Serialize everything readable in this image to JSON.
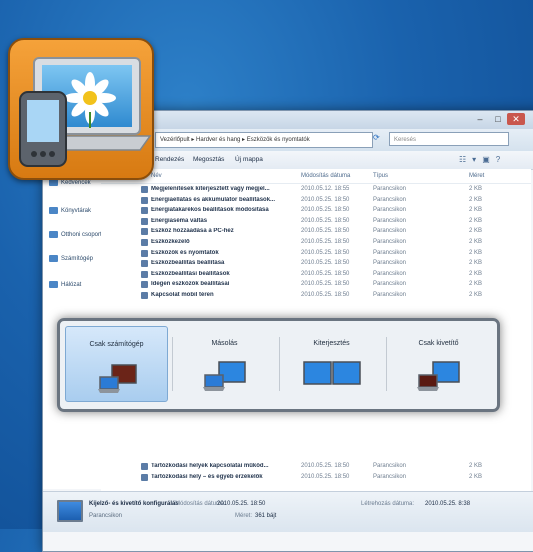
{
  "titlebar": {
    "min": "–",
    "max": "□",
    "close": "✕"
  },
  "address": {
    "path": "Vezérlőpult ▸ Hardver és hang ▸ Eszközök és nyomtatók",
    "search_placeholder": "Keresés"
  },
  "commandbar": {
    "items": [
      "Rendezés",
      "Megosztás",
      "Új mappa"
    ]
  },
  "nav": {
    "items": [
      "Kedvencek",
      "Könyvtárak",
      "Otthoni csoport",
      "Számítógép",
      "Hálózat"
    ]
  },
  "columns": {
    "name": "Név",
    "date": "Módosítás dátuma",
    "type": "Típus",
    "size": "Méret"
  },
  "files": [
    {
      "name": "Megjelenítések kiterjesztett vagy megjel...",
      "date": "2010.05.12. 18:55",
      "type": "Parancsikon",
      "size": "2 KB"
    },
    {
      "name": "Energiaellátás és akkumulátor beállítások...",
      "date": "2010.05.25. 18:50",
      "type": "Parancsikon",
      "size": "2 KB"
    },
    {
      "name": "Energiatakarékos beállítások módosítása",
      "date": "2010.05.25. 18:50",
      "type": "Parancsikon",
      "size": "2 KB"
    },
    {
      "name": "Energiaséma váltás",
      "date": "2010.05.25. 18:50",
      "type": "Parancsikon",
      "size": "2 KB"
    },
    {
      "name": "Eszköz hozzáadása a PC-hez",
      "date": "2010.05.25. 18:50",
      "type": "Parancsikon",
      "size": "2 KB"
    },
    {
      "name": "Eszközkezelő",
      "date": "2010.05.25. 18:50",
      "type": "Parancsikon",
      "size": "2 KB"
    },
    {
      "name": "Eszközök és nyomtatók",
      "date": "2010.05.25. 18:50",
      "type": "Parancsikon",
      "size": "2 KB"
    },
    {
      "name": "Eszközbeállítás beállítása",
      "date": "2010.05.25. 18:50",
      "type": "Parancsikon",
      "size": "2 KB"
    },
    {
      "name": "Eszközbeállítási beállítások",
      "date": "2010.05.25. 18:50",
      "type": "Parancsikon",
      "size": "2 KB"
    },
    {
      "name": "Idegen eszközök beállításai",
      "date": "2010.05.25. 18:50",
      "type": "Parancsikon",
      "size": "2 KB"
    },
    {
      "name": "Kapcsolat mobil téren",
      "date": "2010.05.25. 18:50",
      "type": "Parancsikon",
      "size": "2 KB"
    }
  ],
  "files_after": [
    {
      "name": "Tartózkodási helyek kapcsolatai működ...",
      "date": "2010.05.25. 18:50",
      "type": "Parancsikon",
      "size": "2 KB"
    },
    {
      "name": "Tartózkodási hely – és egyéb érzékelők",
      "date": "2010.05.25. 18:50",
      "type": "Parancsikon",
      "size": "2 KB"
    }
  ],
  "project": {
    "options": [
      {
        "label": "Csak számítógép",
        "selected": true
      },
      {
        "label": "Másolás",
        "selected": false
      },
      {
        "label": "Kiterjesztés",
        "selected": false
      },
      {
        "label": "Csak kivetítő",
        "selected": false
      }
    ]
  },
  "details": {
    "name": "Kijelző- és kivetítő konfigurálás",
    "subtitle": "Parancsikon",
    "k1": "Módosítás dátuma:",
    "v1": "2010.05.25. 18:50",
    "k2": "Létrehozás dátuma:",
    "v2": "2010.05.25. 8:38",
    "k3": "Méret:",
    "v3": "361 bájt"
  },
  "colors": {
    "accent": "#1a62ad",
    "icon_orange": "#e8901f",
    "selection": "#a9cdef"
  }
}
